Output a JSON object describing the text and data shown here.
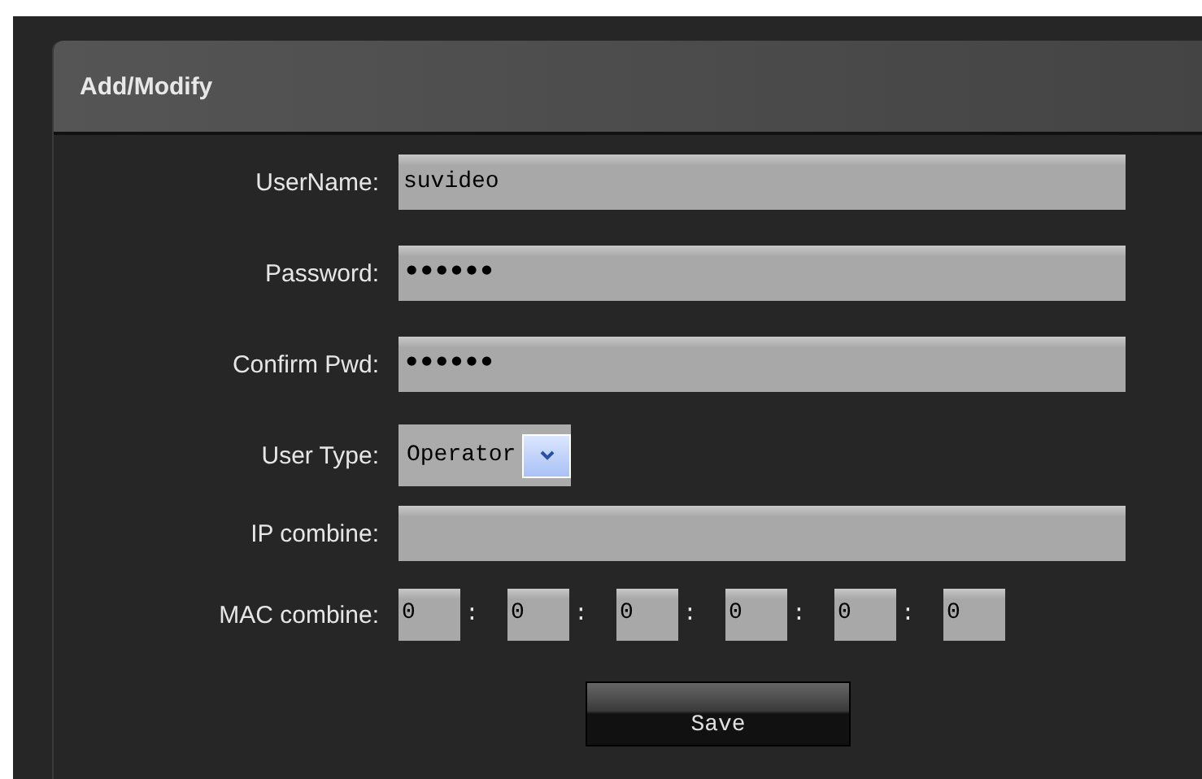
{
  "panel": {
    "title": "Add/Modify"
  },
  "fields": [
    {
      "kind": "text",
      "label": "UserName:",
      "value": "suvideo"
    },
    {
      "kind": "password",
      "label": "Password:",
      "value": "••••••"
    },
    {
      "kind": "password",
      "label": "Confirm Pwd:",
      "value": "••••••"
    },
    {
      "kind": "select",
      "label": "User Type:",
      "value": "Operator"
    },
    {
      "kind": "text",
      "label": "IP combine:"
    },
    {
      "kind": "mac",
      "label": "MAC combine:",
      "parts": [
        "0",
        "0",
        "0",
        "0",
        "0",
        "0"
      ],
      "separators": [
        ":",
        ":",
        ":",
        ":",
        ":"
      ]
    }
  ],
  "buttons": [
    "Save"
  ]
}
